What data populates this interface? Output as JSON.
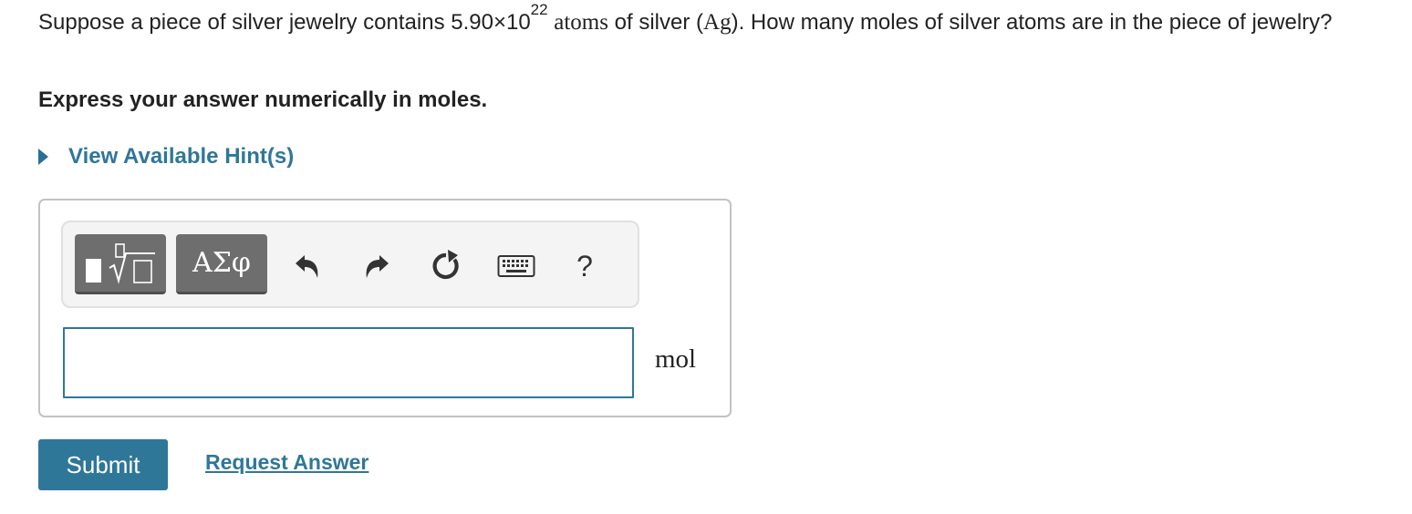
{
  "question": {
    "part1": "Suppose a piece of silver jewelry contains 5.90×10",
    "exponent": "22",
    "atoms_math": "atoms",
    "part2": "of silver (",
    "element_math": "Ag",
    "part3": "). How many moles of silver atoms are in the piece of jewelry?"
  },
  "instruction": "Express your answer numerically in moles.",
  "hint": {
    "label": "View Available Hint(s)",
    "icon": "caret-right-icon"
  },
  "toolbar": {
    "template_button": {
      "icon": "templates-icon"
    },
    "greek_label": "ΑΣφ",
    "undo_icon": "undo-icon",
    "redo_icon": "redo-icon",
    "reset_icon": "reset-icon",
    "keyboard_icon": "keyboard-icon",
    "help_label": "?"
  },
  "answer": {
    "value": "",
    "unit": "mol"
  },
  "actions": {
    "submit": "Submit",
    "request": "Request Answer"
  },
  "colors": {
    "accent": "#2f7799",
    "toolbar_button": "#6e6e6e"
  }
}
